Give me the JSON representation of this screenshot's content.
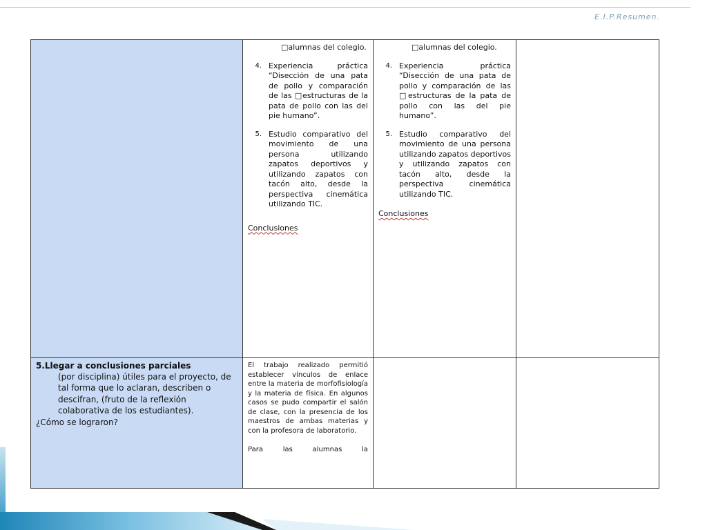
{
  "header": {
    "label": "E.I.P.Resumen."
  },
  "row1": {
    "col_b": {
      "top_line": "□alumnas del colegio.",
      "items": [
        {
          "number": "4.",
          "text": "Experiencia práctica “Disección de una pata de pollo y comparación de las □estructuras de la pata de pollo con las del pie humano”."
        },
        {
          "number": "5.",
          "text": "Estudio comparativo del movimiento de una persona utilizando zapatos deportivos y utilizando zapatos con tacón alto, desde la perspectiva cinemática utilizando TIC."
        }
      ],
      "conclusion": "Conclusiones"
    },
    "col_c": {
      "top_line": "□alumnas del colegio.",
      "items": [
        {
          "number": "4.",
          "text": "Experiencia práctica “Disección de una pata de pollo y comparación de las □estructuras de la pata de pollo con las del pie humano”."
        },
        {
          "number": "5.",
          "text": "Estudio comparativo del movimiento de una persona utilizando zapatos deportivos y utilizando zapatos con tacón alto, desde la perspectiva cinemática utilizando TIC."
        }
      ],
      "conclusion": "Conclusiones"
    }
  },
  "row2": {
    "col_a": {
      "title": "5.Llegar a conclusiones parciales",
      "body": "(por disciplina) útiles para el proyecto, de tal forma que lo aclaran, describen o descifran, (fruto de la reflexión colaborativa de los estudiantes).",
      "question": "¿Cómo se lograron?"
    },
    "col_b": {
      "paragraph": "El trabajo realizado permitió establecer vínculos de enlace entre la materia de morfofisiología y la materia de física. En algunos casos se pudo compartir el salón de clase, con la presencia de los maestros de ambas materias y con la profesora de laboratorio.",
      "last_line": "Para las alumnas la"
    }
  },
  "colors": {
    "table_highlight": "#c9daf5",
    "header_text": "#7f9db0",
    "accent_blue": "#2b90c0"
  }
}
